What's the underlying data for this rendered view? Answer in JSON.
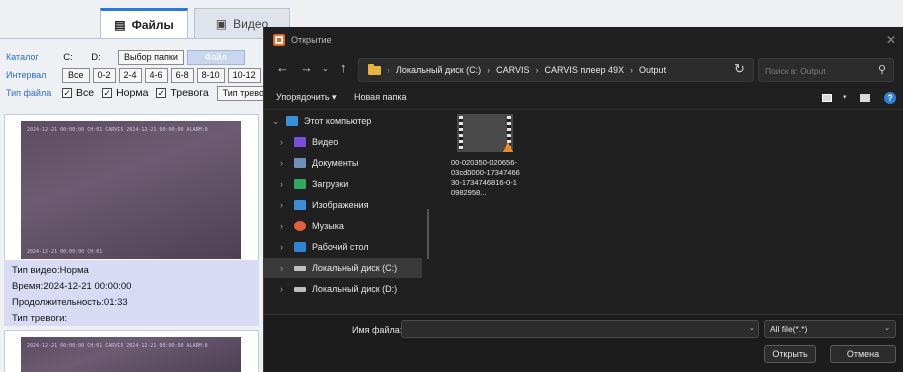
{
  "app": {
    "tabs": [
      {
        "label": "Файлы",
        "icon": "file-icon"
      },
      {
        "label": "Видео",
        "icon": "video-icon"
      }
    ],
    "catalog_label": "Каталог",
    "drive_c": "C:",
    "drive_d": "D:",
    "choose_folder": "Выбор папки",
    "file_btn": "Файл",
    "interval_label": "Интервал",
    "interval_buttons": [
      "Все",
      "0-2",
      "2-4",
      "4-6",
      "6-8",
      "8-10",
      "10-12"
    ],
    "filetype_label": "Тип файла",
    "checks": [
      "Все",
      "Норма",
      "Тревога"
    ],
    "alarm_type_btn": "Тип тревоги",
    "video_overlay_top": "2024-12-21 00:00:00 CH:01 CARVIS 2024-12-21 00:00:00 ALARM:0",
    "video_overlay_bottom": "2024-12-21 00:00:00 CH:01",
    "info": {
      "video_type": "Тип видео:Норма",
      "time": "Время:2024-12-21 00:00:00",
      "duration": "Продолжительность:01:33",
      "alarm_type": "Тип тревоги:"
    }
  },
  "dialog": {
    "title": "Открытие",
    "path": [
      "Локальный диск (C:)",
      "CARVIS",
      "CARVIS плеер 49X",
      "Output"
    ],
    "search_placeholder": "Поиск в: Output",
    "organize": "Упорядочить ▾",
    "new_folder": "Новая папка",
    "sidebar": [
      {
        "label": "Этот компьютер",
        "icon": "computer-icon",
        "color": "#3a8fd8"
      },
      {
        "label": "Видео",
        "icon": "video-folder-icon",
        "color": "#7b4fd9"
      },
      {
        "label": "Документы",
        "icon": "documents-icon",
        "color": "#6d8fb8"
      },
      {
        "label": "Загрузки",
        "icon": "downloads-icon",
        "color": "#2fa860"
      },
      {
        "label": "Изображения",
        "icon": "pictures-icon",
        "color": "#3b8fd6"
      },
      {
        "label": "Музыка",
        "icon": "music-icon",
        "color": "#e0603a"
      },
      {
        "label": "Рабочий стол",
        "icon": "desktop-icon",
        "color": "#2f83d0"
      },
      {
        "label": "Локальный диск (C:)",
        "icon": "drive-icon",
        "color": "#bfbfbf"
      },
      {
        "label": "Локальный диск (D:)",
        "icon": "drive-icon",
        "color": "#bfbfbf"
      }
    ],
    "file": {
      "name": "00-020350-020656-03cd0000-1734746630-1734746816-0-10982958..."
    },
    "filename_label": "Имя файла:",
    "filename_value": "",
    "filter": "All file(*.*)",
    "open_btn": "Открыть",
    "cancel_btn": "Отмена"
  }
}
